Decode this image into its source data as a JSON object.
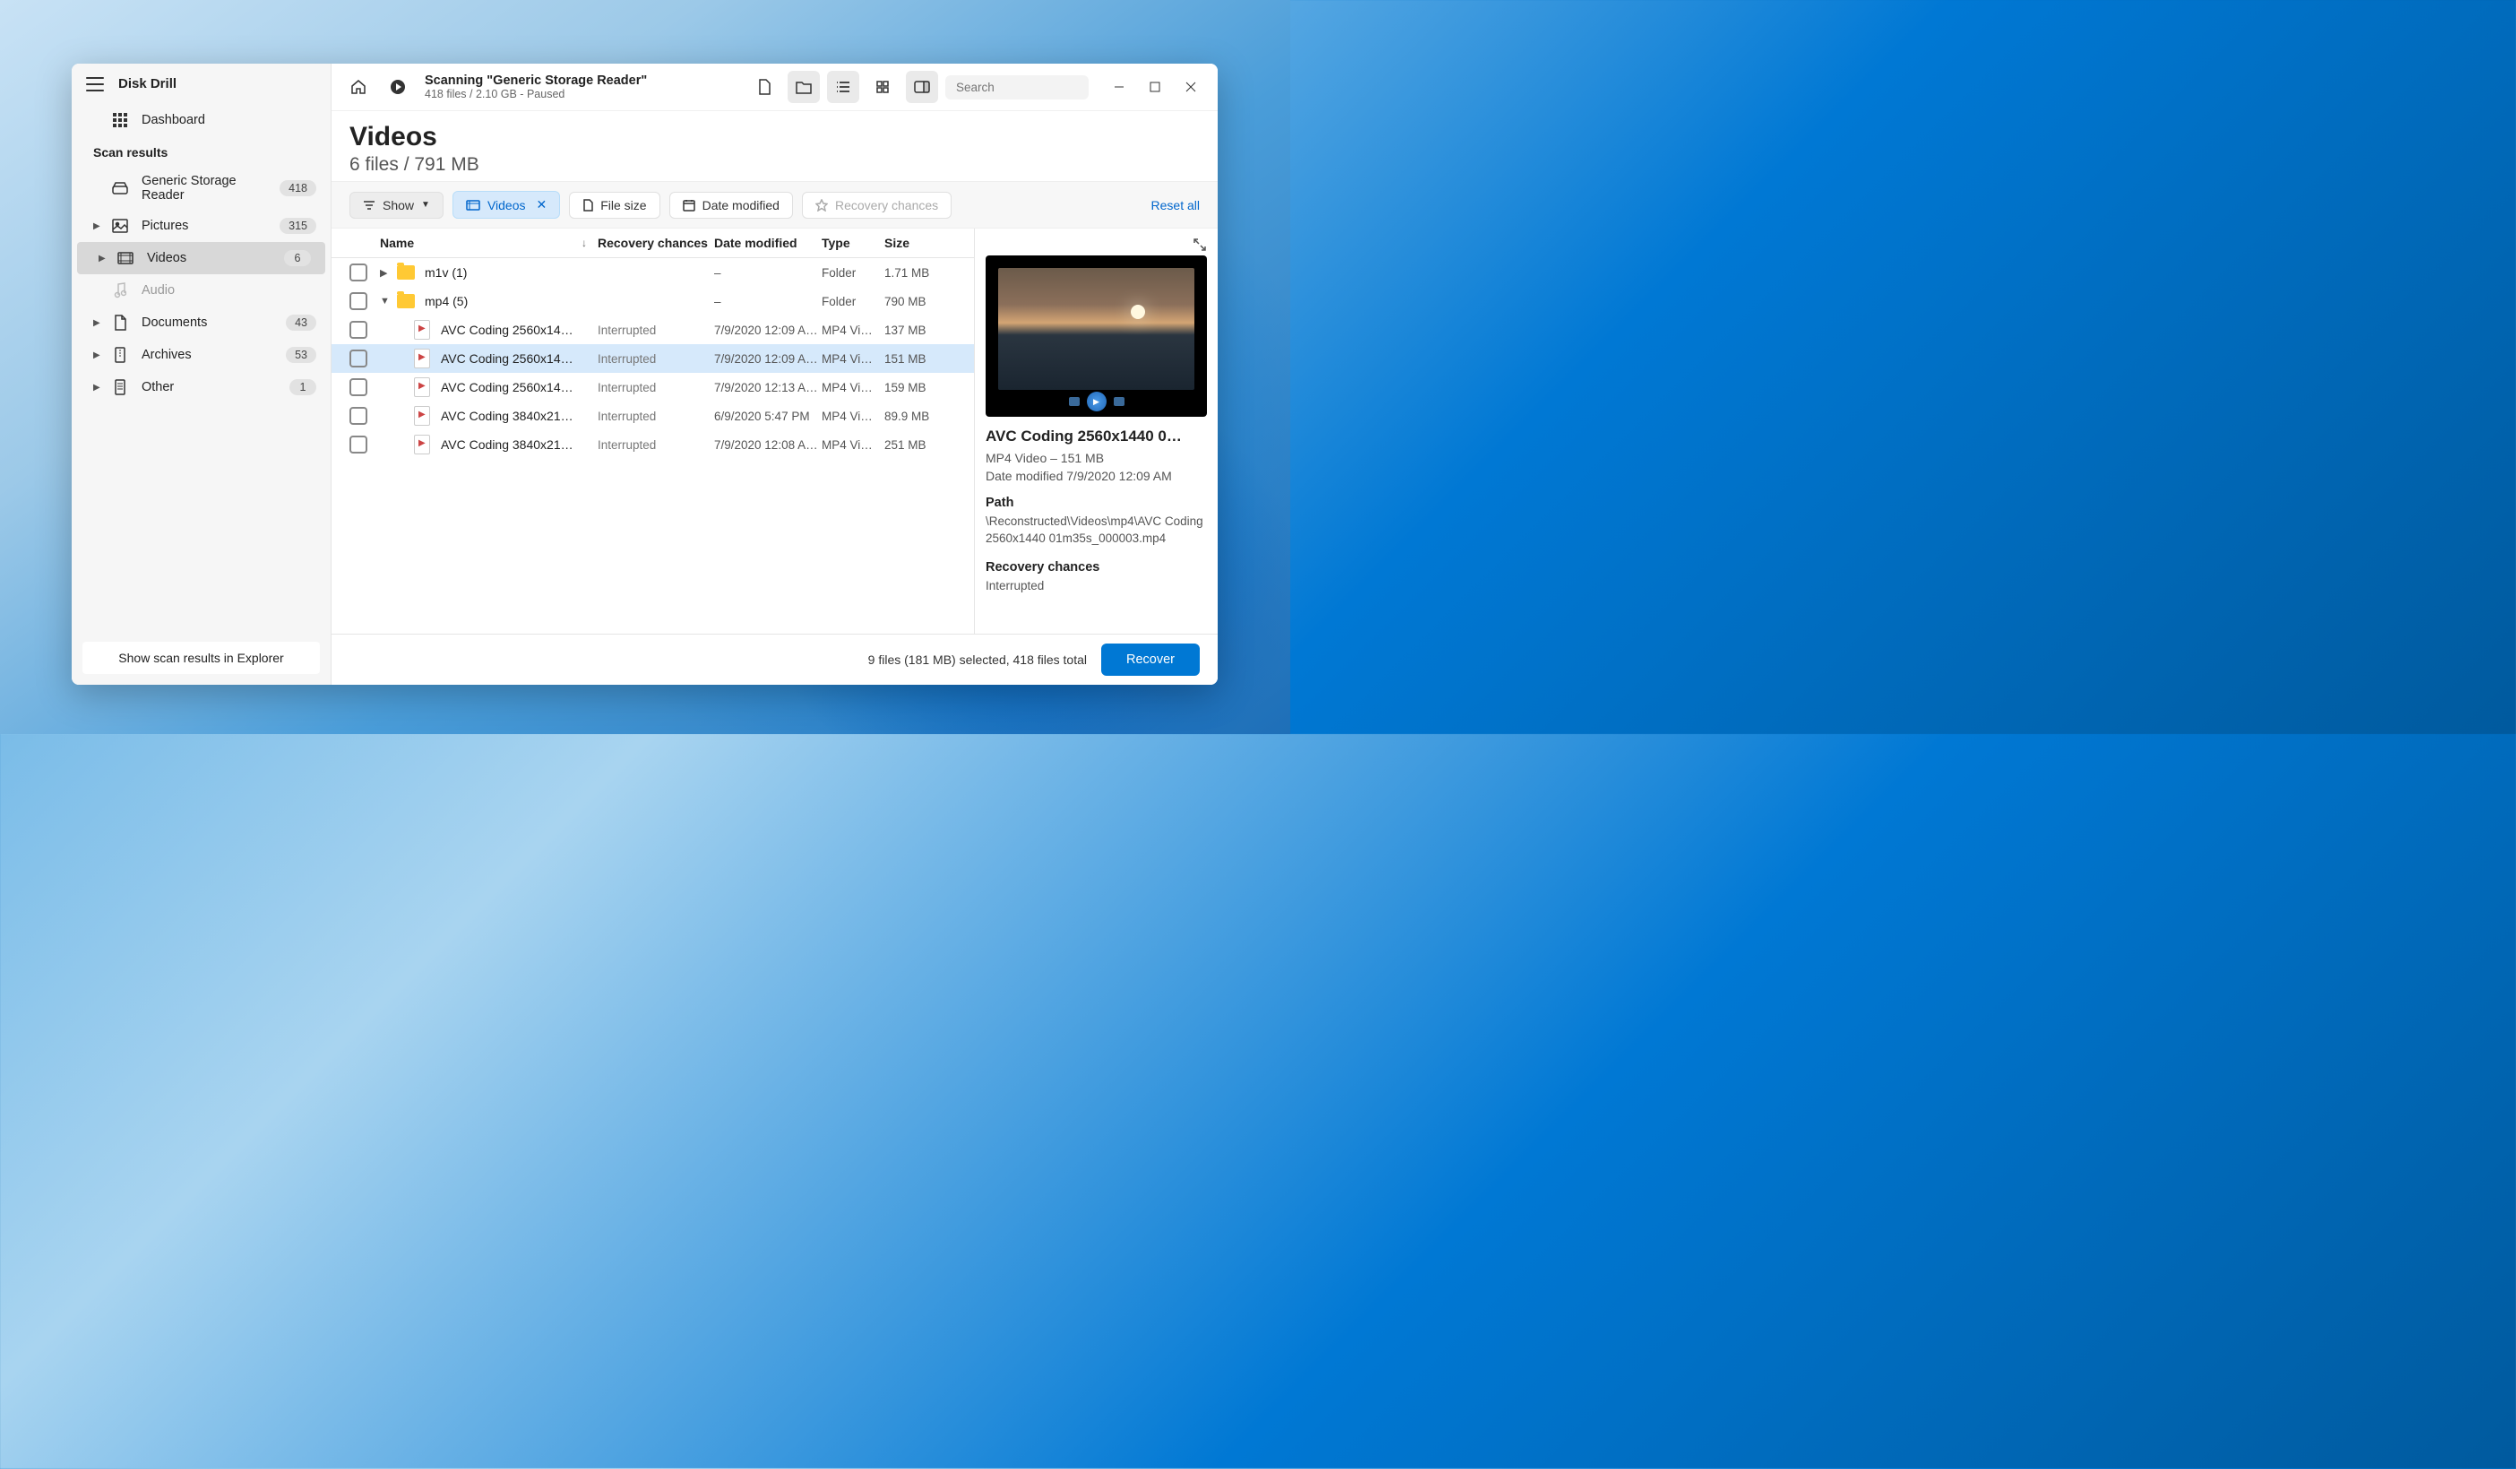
{
  "app": {
    "title": "Disk Drill"
  },
  "sidebar": {
    "dashboard": "Dashboard",
    "section_label": "Scan results",
    "items": [
      {
        "label": "Generic Storage Reader",
        "count": "418",
        "icon": "disk"
      },
      {
        "label": "Pictures",
        "count": "315",
        "icon": "image"
      },
      {
        "label": "Videos",
        "count": "6",
        "icon": "video"
      },
      {
        "label": "Audio",
        "count": "",
        "icon": "audio"
      },
      {
        "label": "Documents",
        "count": "43",
        "icon": "document"
      },
      {
        "label": "Archives",
        "count": "53",
        "icon": "archive"
      },
      {
        "label": "Other",
        "count": "1",
        "icon": "other"
      }
    ],
    "explorer_btn": "Show scan results in Explorer"
  },
  "toolbar": {
    "scan_title": "Scanning \"Generic Storage Reader\"",
    "scan_sub": "418 files / 2.10 GB - Paused",
    "search_placeholder": "Search"
  },
  "header": {
    "title": "Videos",
    "subtitle": "6 files / 791 MB"
  },
  "filters": {
    "show": "Show",
    "videos": "Videos",
    "file_size": "File size",
    "date_modified": "Date modified",
    "recovery_chances": "Recovery chances",
    "reset": "Reset all"
  },
  "columns": {
    "name": "Name",
    "recovery": "Recovery chances",
    "date": "Date modified",
    "type": "Type",
    "size": "Size"
  },
  "rows": [
    {
      "kind": "folder",
      "name": "m1v (1)",
      "recovery": "",
      "date": "–",
      "type": "Folder",
      "size": "1.71 MB",
      "expanded": false,
      "depth": 0
    },
    {
      "kind": "folder",
      "name": "mp4 (5)",
      "recovery": "",
      "date": "–",
      "type": "Folder",
      "size": "790 MB",
      "expanded": true,
      "depth": 0
    },
    {
      "kind": "file",
      "name": "AVC Coding 2560x14…",
      "recovery": "Interrupted",
      "date": "7/9/2020 12:09 A…",
      "type": "MP4 Vi…",
      "size": "137 MB",
      "depth": 1
    },
    {
      "kind": "file",
      "name": "AVC Coding 2560x14…",
      "recovery": "Interrupted",
      "date": "7/9/2020 12:09 A…",
      "type": "MP4 Vi…",
      "size": "151 MB",
      "depth": 1,
      "selected": true
    },
    {
      "kind": "file",
      "name": "AVC Coding 2560x14…",
      "recovery": "Interrupted",
      "date": "7/9/2020 12:13 A…",
      "type": "MP4 Vi…",
      "size": "159 MB",
      "depth": 1
    },
    {
      "kind": "file",
      "name": "AVC Coding 3840x21…",
      "recovery": "Interrupted",
      "date": "6/9/2020 5:47 PM",
      "type": "MP4 Vi…",
      "size": "89.9 MB",
      "depth": 1
    },
    {
      "kind": "file",
      "name": "AVC Coding 3840x21…",
      "recovery": "Interrupted",
      "date": "7/9/2020 12:08 A…",
      "type": "MP4 Vi…",
      "size": "251 MB",
      "depth": 1
    }
  ],
  "preview": {
    "title": "AVC Coding 2560x1440 0…",
    "type_size": "MP4 Video – 151 MB",
    "date_modified": "Date modified 7/9/2020 12:09 AM",
    "path_label": "Path",
    "path_value": "\\Reconstructed\\Videos\\mp4\\AVC Coding 2560x1440 01m35s_000003.mp4",
    "recovery_label": "Recovery chances",
    "recovery_value": "Interrupted"
  },
  "footer": {
    "status": "9 files (181 MB) selected, 418 files total",
    "recover": "Recover"
  }
}
